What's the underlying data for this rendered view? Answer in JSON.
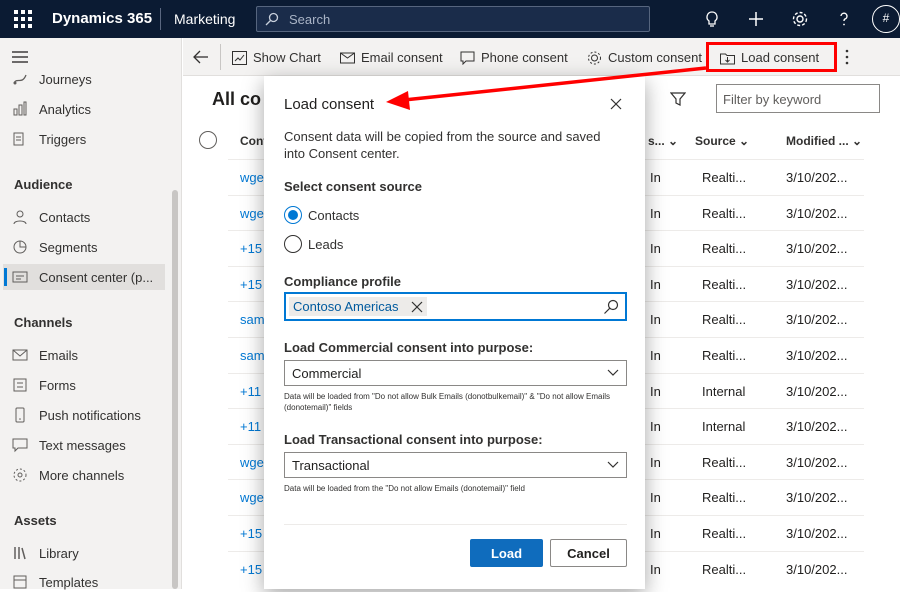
{
  "topbar": {
    "app_name": "Dynamics 365",
    "module": "Marketing",
    "search_placeholder": "Search",
    "avatar_initial": "#"
  },
  "sidebar": {
    "items_top": [
      {
        "label": "Journeys",
        "icon": "journeys-icon"
      },
      {
        "label": "Analytics",
        "icon": "analytics-icon"
      },
      {
        "label": "Triggers",
        "icon": "triggers-icon"
      }
    ],
    "audience_heading": "Audience",
    "audience_items": [
      {
        "label": "Contacts",
        "icon": "contact-icon"
      },
      {
        "label": "Segments",
        "icon": "segments-icon"
      },
      {
        "label": "Consent center (p...",
        "icon": "consent-icon"
      }
    ],
    "channels_heading": "Channels",
    "channels_items": [
      {
        "label": "Emails",
        "icon": "email-icon"
      },
      {
        "label": "Forms",
        "icon": "forms-icon"
      },
      {
        "label": "Push notifications",
        "icon": "push-icon"
      },
      {
        "label": "Text messages",
        "icon": "text-message-icon"
      },
      {
        "label": "More channels",
        "icon": "more-channels-icon"
      }
    ],
    "assets_heading": "Assets",
    "assets_items": [
      {
        "label": "Library",
        "icon": "library-icon"
      },
      {
        "label": "Templates",
        "icon": "templates-icon"
      }
    ]
  },
  "commandbar": {
    "show_chart": "Show Chart",
    "email_consent": "Email consent",
    "phone_consent": "Phone consent",
    "custom_consent": "Custom consent",
    "load_consent": "Load consent"
  },
  "list": {
    "title": "All co",
    "filter_placeholder": "Filter by keyword",
    "headers": {
      "contact": "Cont",
      "status": "s...",
      "source": "Source",
      "modified": "Modified ..."
    },
    "rows": [
      {
        "contact": "wge",
        "status": "In",
        "source": "Realti...",
        "modified": "3/10/202..."
      },
      {
        "contact": "wge",
        "status": "In",
        "source": "Realti...",
        "modified": "3/10/202..."
      },
      {
        "contact": "+15",
        "status": "In",
        "source": "Realti...",
        "modified": "3/10/202..."
      },
      {
        "contact": "+15",
        "status": "In",
        "source": "Realti...",
        "modified": "3/10/202..."
      },
      {
        "contact": "sam",
        "status": "In",
        "source": "Realti...",
        "modified": "3/10/202..."
      },
      {
        "contact": "sam",
        "status": "In",
        "source": "Realti...",
        "modified": "3/10/202..."
      },
      {
        "contact": "+11",
        "status": "In",
        "source": "Internal",
        "modified": "3/10/202..."
      },
      {
        "contact": "+11",
        "status": "In",
        "source": "Internal",
        "modified": "3/10/202..."
      },
      {
        "contact": "wge",
        "status": "In",
        "source": "Realti...",
        "modified": "3/10/202..."
      },
      {
        "contact": "wge",
        "status": "In",
        "source": "Realti...",
        "modified": "3/10/202..."
      },
      {
        "contact": "+15",
        "status": "In",
        "source": "Realti...",
        "modified": "3/10/202..."
      },
      {
        "contact": "+15",
        "status": "In",
        "source": "Realti...",
        "modified": "3/10/202..."
      }
    ]
  },
  "dialog": {
    "title": "Load consent",
    "description": "Consent data will be copied from the source and saved into Consent center.",
    "source_label": "Select consent source",
    "source_options": [
      "Contacts",
      "Leads"
    ],
    "source_selected": "Contacts",
    "profile_label": "Compliance profile",
    "profile_value": "Contoso Americas",
    "commercial_label": "Load Commercial consent into purpose:",
    "commercial_value": "Commercial",
    "commercial_hint": "Data will be loaded from \"Do not allow Bulk Emails (donotbulkemail)\" & \"Do not allow Emails (donotemail)\" fields",
    "transactional_label": "Load Transactional consent into purpose:",
    "transactional_value": "Transactional",
    "transactional_hint": "Data will be loaded from the \"Do not allow Emails (donotemail)\" field",
    "load_button": "Load",
    "cancel_button": "Cancel"
  },
  "colors": {
    "topbar": "#0b1b33",
    "accent": "#0078d4",
    "highlight": "#ff0000"
  }
}
